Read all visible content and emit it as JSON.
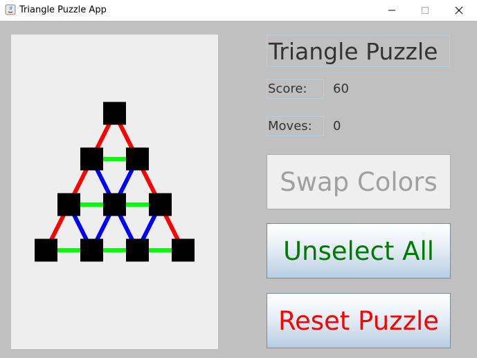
{
  "window": {
    "title": "Triangle Puzzle App"
  },
  "panel": {
    "title": "Triangle Puzzle",
    "score_label": "Score:",
    "score_value": "60",
    "moves_label": "Moves:",
    "moves_value": "0"
  },
  "buttons": {
    "swap": "Swap Colors",
    "unselect": "Unselect All",
    "reset": "Reset Puzzle"
  },
  "colors": {
    "red": "#ff0000",
    "green": "#00ff00",
    "blue": "#0000ff",
    "node": "#000000",
    "unselect_text": "#007a00",
    "reset_text": "#ff0000",
    "disabled_text": "#a0a0a0"
  },
  "puzzle": {
    "rows": 4,
    "edges": [
      {
        "from": [
          0,
          0
        ],
        "to": [
          1,
          0
        ],
        "color": "red"
      },
      {
        "from": [
          0,
          0
        ],
        "to": [
          1,
          1
        ],
        "color": "red"
      },
      {
        "from": [
          1,
          0
        ],
        "to": [
          1,
          1
        ],
        "color": "green"
      },
      {
        "from": [
          1,
          0
        ],
        "to": [
          2,
          0
        ],
        "color": "red"
      },
      {
        "from": [
          1,
          0
        ],
        "to": [
          2,
          1
        ],
        "color": "blue"
      },
      {
        "from": [
          1,
          1
        ],
        "to": [
          2,
          1
        ],
        "color": "blue"
      },
      {
        "from": [
          1,
          1
        ],
        "to": [
          2,
          2
        ],
        "color": "red"
      },
      {
        "from": [
          2,
          0
        ],
        "to": [
          2,
          1
        ],
        "color": "green"
      },
      {
        "from": [
          2,
          1
        ],
        "to": [
          2,
          2
        ],
        "color": "green"
      },
      {
        "from": [
          2,
          0
        ],
        "to": [
          3,
          0
        ],
        "color": "red"
      },
      {
        "from": [
          2,
          0
        ],
        "to": [
          3,
          1
        ],
        "color": "blue"
      },
      {
        "from": [
          2,
          1
        ],
        "to": [
          3,
          1
        ],
        "color": "blue"
      },
      {
        "from": [
          2,
          1
        ],
        "to": [
          3,
          2
        ],
        "color": "blue"
      },
      {
        "from": [
          2,
          2
        ],
        "to": [
          3,
          2
        ],
        "color": "blue"
      },
      {
        "from": [
          2,
          2
        ],
        "to": [
          3,
          3
        ],
        "color": "red"
      },
      {
        "from": [
          3,
          0
        ],
        "to": [
          3,
          1
        ],
        "color": "green"
      },
      {
        "from": [
          3,
          1
        ],
        "to": [
          3,
          2
        ],
        "color": "green"
      },
      {
        "from": [
          3,
          2
        ],
        "to": [
          3,
          3
        ],
        "color": "green"
      }
    ]
  }
}
